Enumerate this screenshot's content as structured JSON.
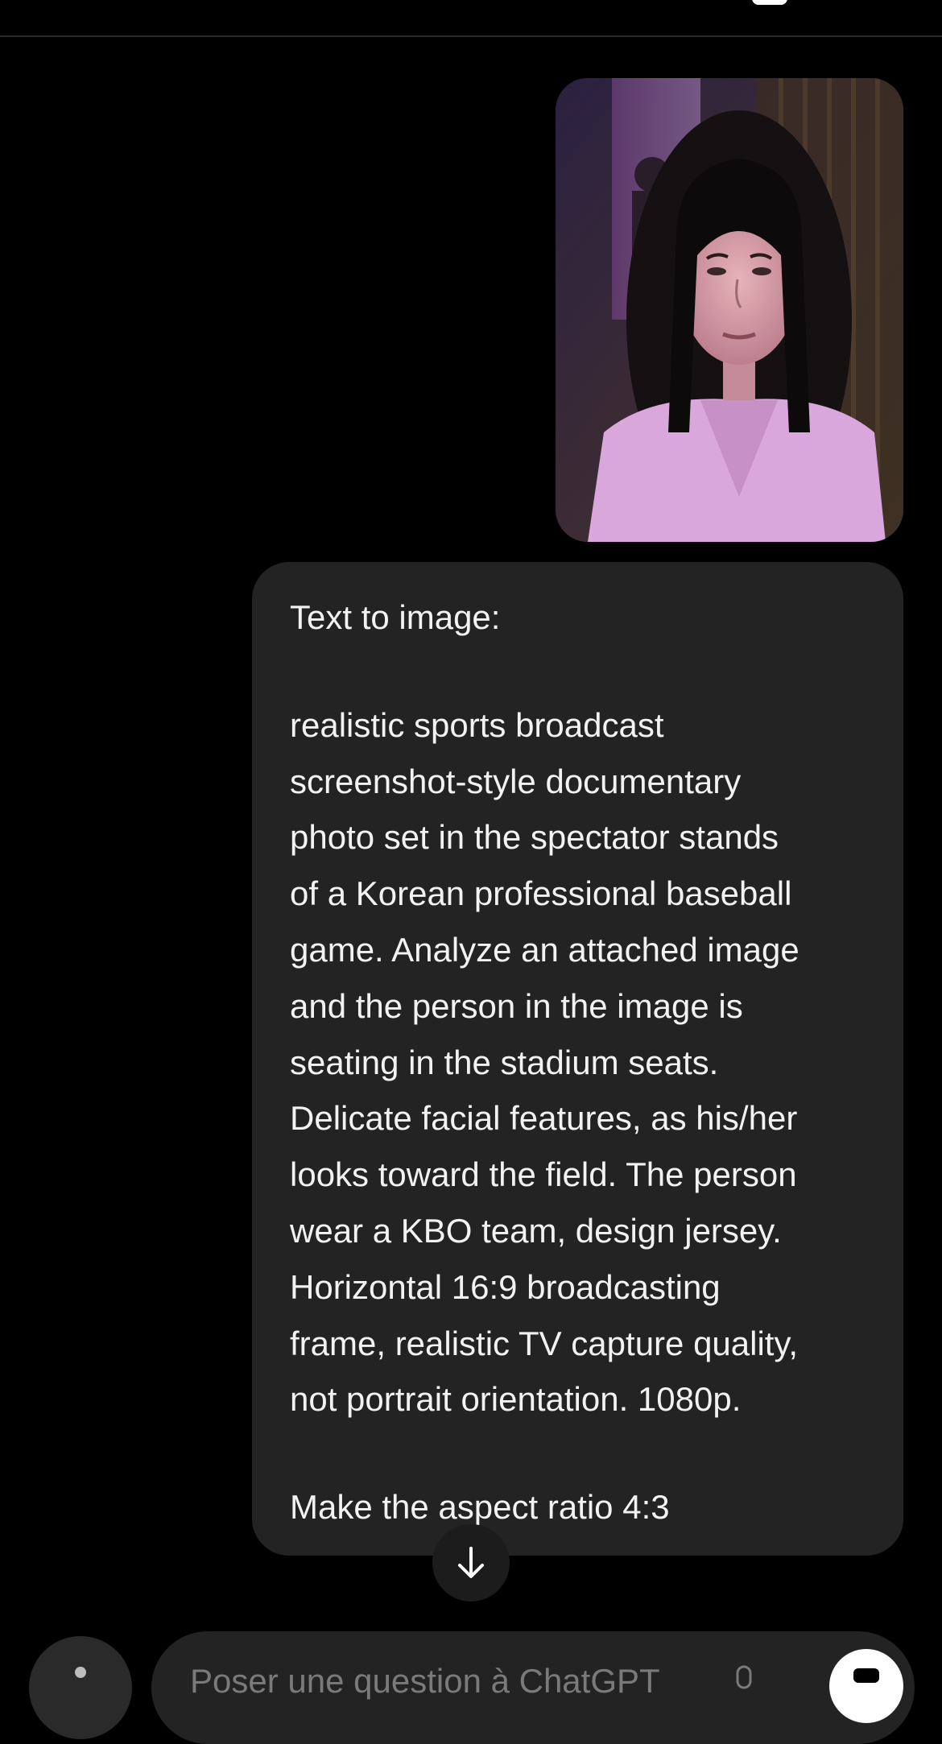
{
  "header": {
    "icon": "square-icon"
  },
  "message": {
    "image_alt": "Attached photo",
    "lines_intro": "Text to image:",
    "prompt_lines": [
      "realistic sports broadcast",
      "screenshot-style documentary",
      "photo set in the spectator stands",
      "of a Korean professional baseball",
      "game. Analyze an attached image",
      "and the person in the image is",
      "seating in the stadium seats.",
      "Delicate facial features, as his/her",
      "looks toward the field. The person",
      "wear a KBO team, design jersey.",
      "Horizontal 16:9 broadcasting",
      "frame, realistic TV capture quality,",
      "not portrait orientation. 1080p."
    ],
    "line_final": "Make the aspect ratio 4:3"
  },
  "scroll_button": {
    "icon": "arrow-down-icon"
  },
  "composer": {
    "placeholder": "Poser une question à ChatGPT",
    "attach_icon": "plus-icon",
    "mic_icon": "microphone-icon",
    "voice_icon": "voice-mode-icon"
  },
  "colors": {
    "background": "#000000",
    "bubble": "#232323",
    "text": "#f2f2f2",
    "placeholder": "#7a7a7a"
  }
}
